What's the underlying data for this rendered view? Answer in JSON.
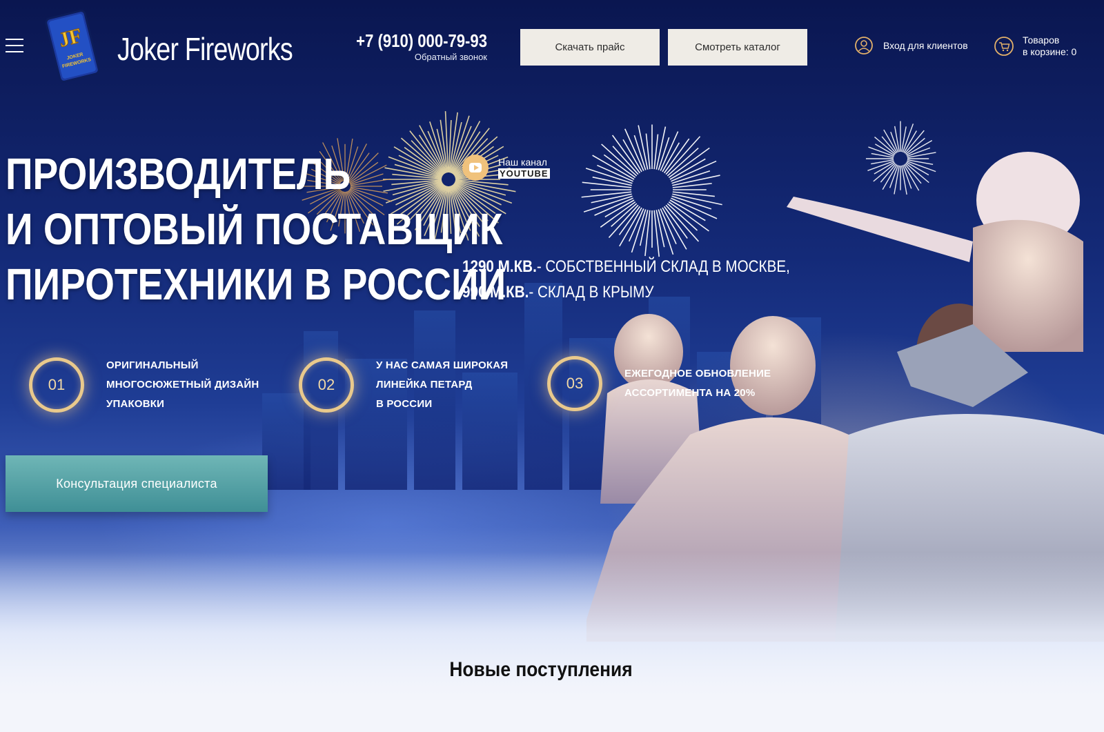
{
  "header": {
    "brand": "Joker Fireworks",
    "logo_text": "JF",
    "logo_sub": "JOKER FIREWORKS",
    "phone": "+7 (910) 000-79-93",
    "callback": "Обратный звонок",
    "price_button": "Скачать прайс",
    "catalog_button": "Смотреть каталог",
    "login": "Вход для клиентов",
    "cart_line1": "Товаров",
    "cart_line2": "в корзине: 0"
  },
  "hero": {
    "headline_1": "ПРОИЗВОДИТЕЛЬ",
    "headline_2": "И ОПТОВЫЙ ПОСТАВЩИК",
    "headline_3": "ПИРОТЕХНИКИ В РОССИИ",
    "youtube_label": "Наш канал",
    "youtube_name": "YOUTUBE",
    "stat1_value": "1290 М.КВ.",
    "stat1_text": "- СОБСТВЕННЫЙ СКЛАД В МОСКВЕ,",
    "stat2_value": "990 М.КВ.",
    "stat2_text": "- СКЛАД В КРЫМУ"
  },
  "features": [
    {
      "num": "01",
      "line1": "ОРИГИНАЛЬНЫЙ",
      "line2": "МНОГОСЮЖЕТНЫЙ ДИЗАЙН",
      "line3": "УПАКОВКИ"
    },
    {
      "num": "02",
      "line1": "У НАС САМАЯ ШИРОКАЯ",
      "line2": "ЛИНЕЙКА ПЕТАРД",
      "line3": "В РОССИИ"
    },
    {
      "num": "03",
      "line1": "ЕЖЕГОДНОЕ ОБНОВЛЕНИЕ",
      "line2": "АССОРТИМЕНТА НА 20%"
    }
  ],
  "consult_button": "Консультация специалиста",
  "new_arrivals_title": "Новые поступления",
  "colors": {
    "accent_gold": "#e9c98c",
    "consult_teal": "#4f9fa5",
    "button_light": "#efece6"
  }
}
